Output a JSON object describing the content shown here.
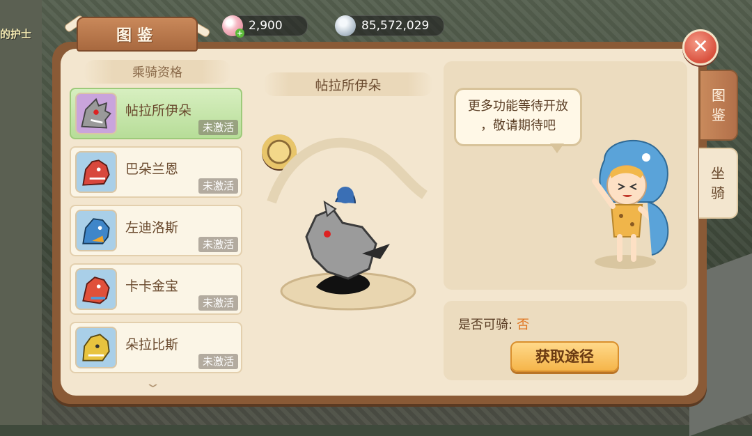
{
  "background": {
    "npc_text": "的护士"
  },
  "currency": {
    "pearl": {
      "icon": "pink-pearl-icon",
      "value": "2,900",
      "plus_icon": "plus-icon"
    },
    "stone": {
      "icon": "stone-coin-icon",
      "value": "85,572,029"
    }
  },
  "window": {
    "title": "图鉴",
    "close_icon": "close-x-icon"
  },
  "list": {
    "header": "乘骑资格",
    "items": [
      {
        "name": "帖拉所伊朵",
        "status": "未激活",
        "selected": true,
        "color": "#c9c9c9"
      },
      {
        "name": "巴朵兰恩",
        "status": "未激活",
        "selected": false,
        "color": "#d8473d"
      },
      {
        "name": "左迪洛斯",
        "status": "未激活",
        "selected": false,
        "color": "#3f86c9"
      },
      {
        "name": "卡卡金宝",
        "status": "未激活",
        "selected": false,
        "color": "#e0503a"
      },
      {
        "name": "朵拉比斯",
        "status": "未激活",
        "selected": false,
        "color": "#e8c33f"
      }
    ],
    "scroll_icon": "chevron-down-icon"
  },
  "detail": {
    "name": "帖拉所伊朵",
    "badge_icon": "rank-badge-icon"
  },
  "info": {
    "bubble_line1": "更多功能等待开放",
    "bubble_line2": "，敬请期待吧"
  },
  "ride": {
    "label": "是否可骑:",
    "value": "否",
    "button": "获取途径"
  },
  "tabs": {
    "tab1": {
      "line1": "图",
      "line2": "鉴"
    },
    "tab2": {
      "line1": "坐",
      "line2": "骑"
    }
  },
  "colors": {
    "accent": "#e0741e",
    "selected_item": "#b7dd98",
    "panel": "#8a5a36"
  }
}
